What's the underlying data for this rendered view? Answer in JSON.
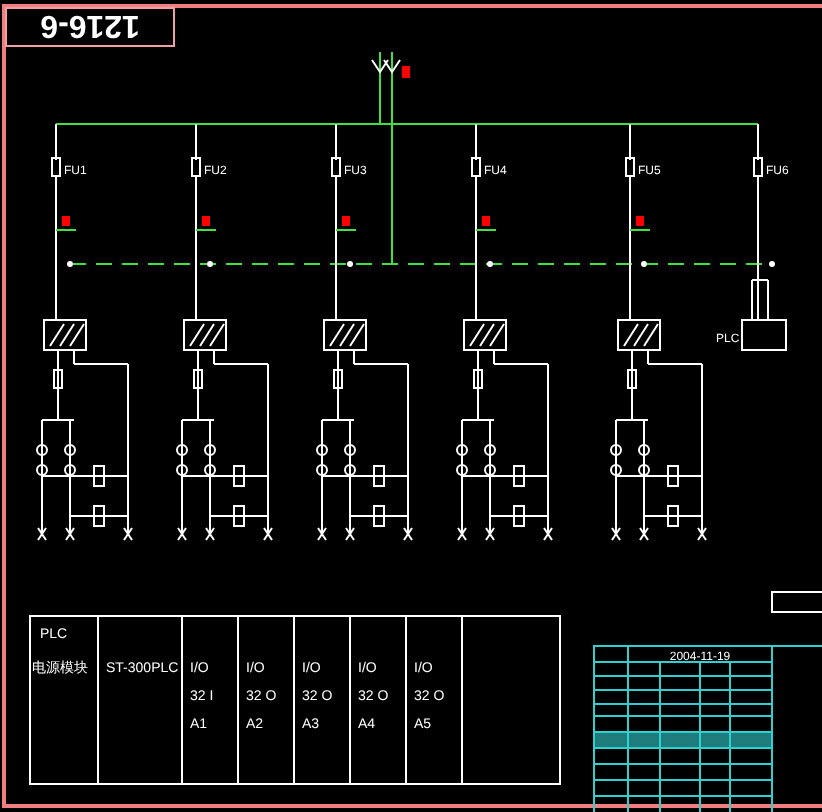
{
  "title_box": "1216-6",
  "fuses": [
    {
      "label": "FU1"
    },
    {
      "label": "FU2"
    },
    {
      "label": "FU3"
    },
    {
      "label": "FU4"
    },
    {
      "label": "FU5"
    },
    {
      "label": "FU6"
    }
  ],
  "plc_box": "PLC",
  "module_table": {
    "rows": [
      [
        "PLC",
        "",
        "",
        "",
        "",
        "",
        "",
        ""
      ],
      [
        "电源模块",
        "ST-300PLC",
        "I/O",
        "I/O",
        "I/O",
        "I/O",
        "I/O",
        ""
      ],
      [
        "",
        "",
        "32 I",
        "32 O",
        "32 O",
        "32 O",
        "32 O",
        ""
      ],
      [
        "",
        "",
        "A1",
        "A2",
        "A3",
        "A4",
        "A5",
        ""
      ]
    ]
  },
  "title_block": {
    "date": "2004-11-19"
  }
}
